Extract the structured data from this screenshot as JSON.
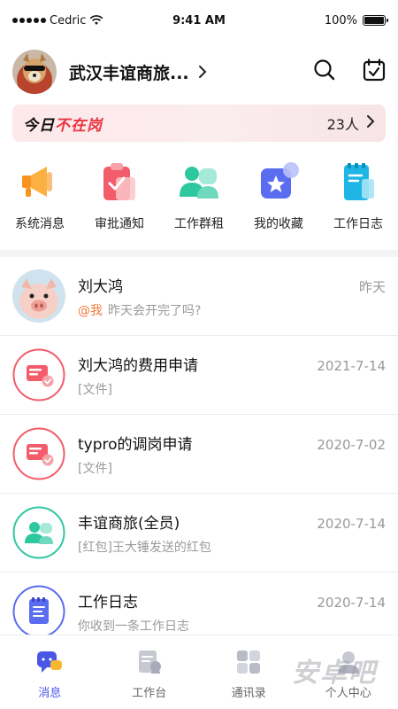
{
  "status_bar": {
    "carrier": "Cedric",
    "time": "9:41 AM",
    "battery": "100%",
    "battery_level": 1.0
  },
  "header": {
    "org_name": "武汉丰谊商旅...",
    "search_icon": "search-icon",
    "calendar_icon": "calendar-check-icon"
  },
  "absent_banner": {
    "title_prefix": "今日",
    "title_highlight": "不在岗",
    "count": "23人"
  },
  "quick_actions": [
    {
      "label": "系统消息",
      "icon": "megaphone-icon",
      "color": "#f7931e"
    },
    {
      "label": "审批通知",
      "icon": "clipboard-check-icon",
      "color": "#f25c6b"
    },
    {
      "label": "工作群租",
      "icon": "group-icon",
      "color": "#2dc7a0"
    },
    {
      "label": "我的收藏",
      "icon": "star-box-icon",
      "color": "#5a6cf0"
    },
    {
      "label": "工作日志",
      "icon": "notebook-icon",
      "color": "#1fb6e6"
    }
  ],
  "conversations": [
    {
      "name": "刘大鸿",
      "time": "昨天",
      "mention": "@我",
      "preview": "昨天会开完了吗?",
      "avatar": "pig-avatar"
    },
    {
      "name": "刘大鸿的费用申请",
      "time": "2021-7-14",
      "mention": "",
      "preview": "[文件]",
      "avatar": "approval-icon"
    },
    {
      "name": "typro的调岗申请",
      "time": "2020-7-02",
      "mention": "",
      "preview": "[文件]",
      "avatar": "approval-icon"
    },
    {
      "name": "丰谊商旅(全员)",
      "time": "2020-7-14",
      "mention": "",
      "preview": "[红包]王大锤发送的红包",
      "avatar": "group-icon"
    },
    {
      "name": "工作日志",
      "time": "2020-7-14",
      "mention": "",
      "preview": "你收到一条工作日志",
      "avatar": "notebook-icon"
    }
  ],
  "tabs": [
    {
      "label": "消息",
      "icon": "chat-icon",
      "active": true
    },
    {
      "label": "工作台",
      "icon": "workbench-icon",
      "active": false
    },
    {
      "label": "通讯录",
      "icon": "contacts-icon",
      "active": false
    },
    {
      "label": "个人中心",
      "icon": "profile-icon",
      "active": false
    }
  ],
  "watermark": "安卓吧",
  "colors": {
    "accent": "#4a57e6",
    "alert_red": "#e8343f",
    "mention_orange": "#f07a3a"
  }
}
